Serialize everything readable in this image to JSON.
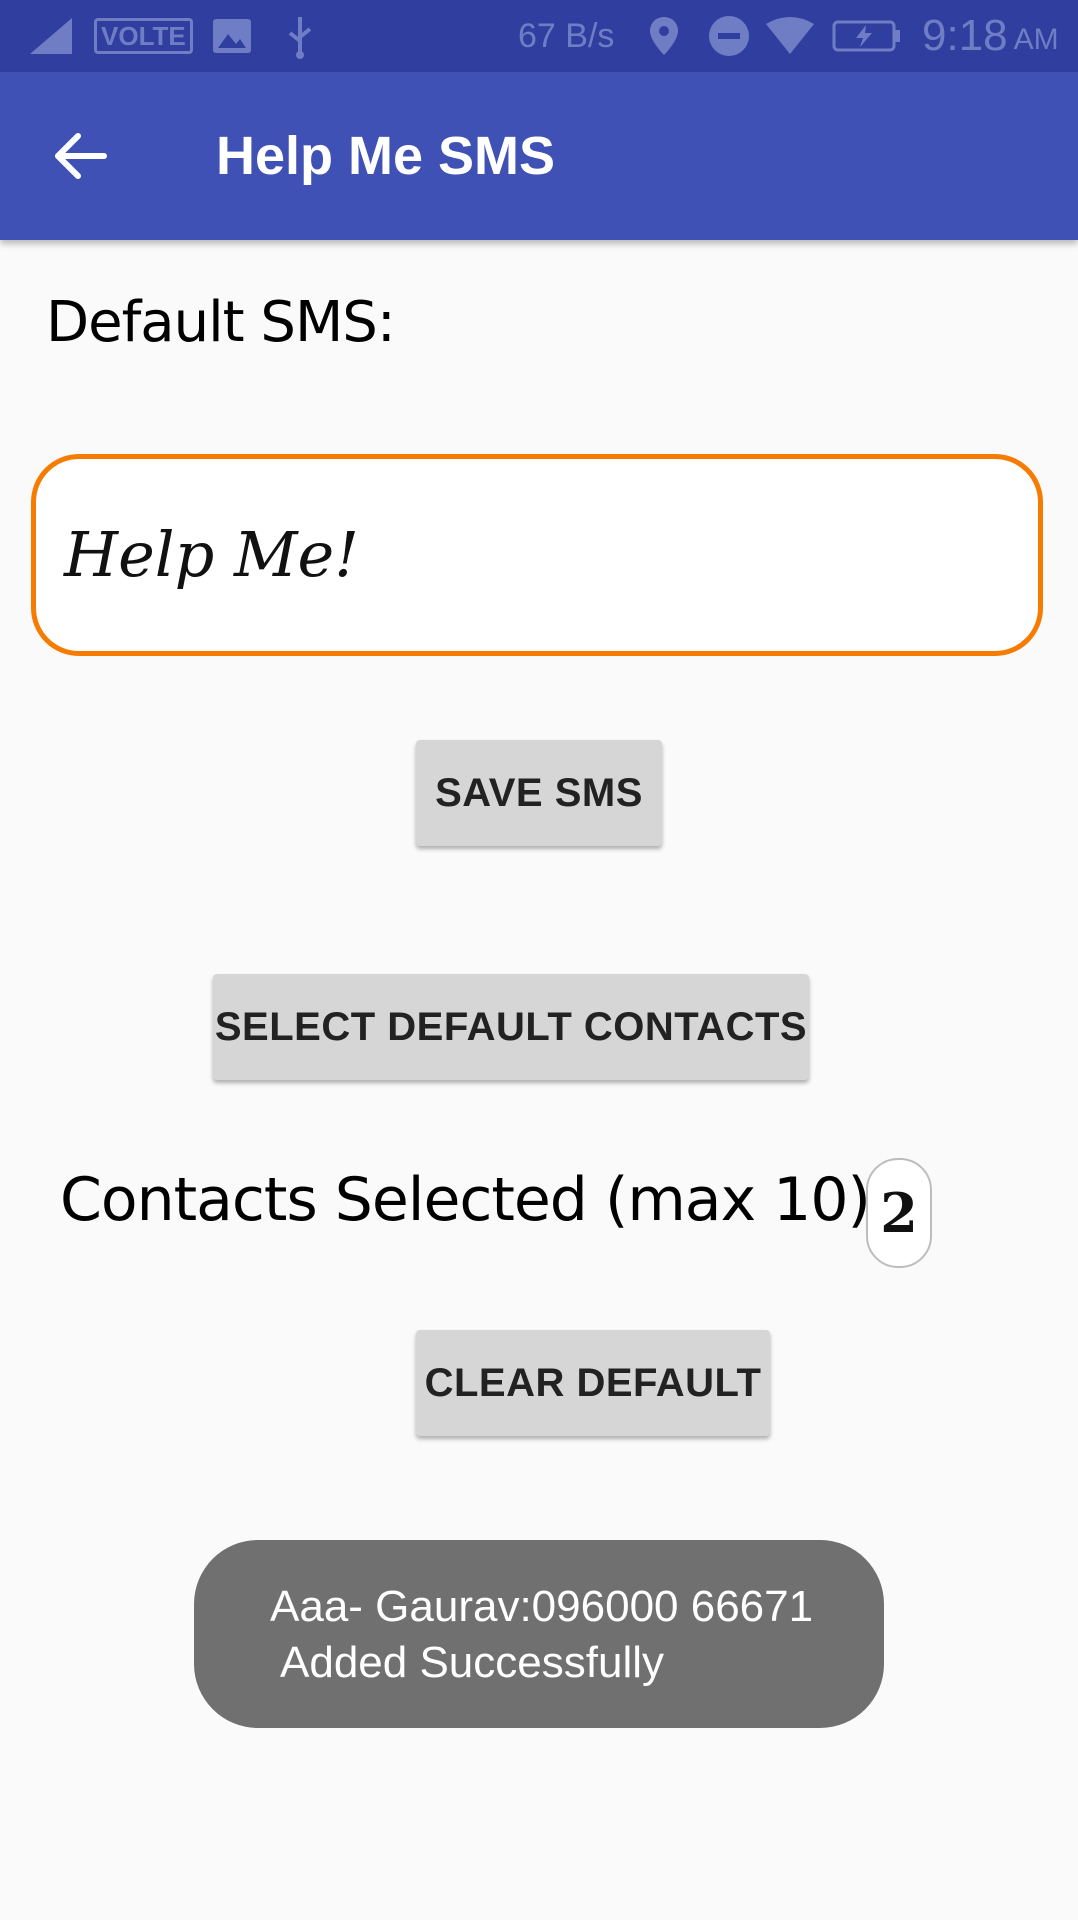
{
  "status_bar": {
    "network_label": "VOLTE",
    "speed": "67 B/s",
    "time": "9:18",
    "ampm": "AM"
  },
  "app_bar": {
    "title": "Help Me SMS"
  },
  "main": {
    "default_sms_label": "Default SMS:",
    "sms_value": "Help Me!",
    "save_button": "SAVE SMS",
    "select_contacts_button": "SELECT DEFAULT CONTACTS",
    "contacts_selected_label": "Contacts Selected (max 10):",
    "contacts_count": "2",
    "clear_button": "CLEAR DEFAULT"
  },
  "toast": {
    "line1": "Aaa- Gaurav:096000 66671",
    "line2": "Added Successfully"
  },
  "colors": {
    "status_bar": "#303f9f",
    "app_bar": "#3f51b5",
    "input_border": "#f57c00",
    "button": "#d6d6d6",
    "toast": "#707070"
  }
}
